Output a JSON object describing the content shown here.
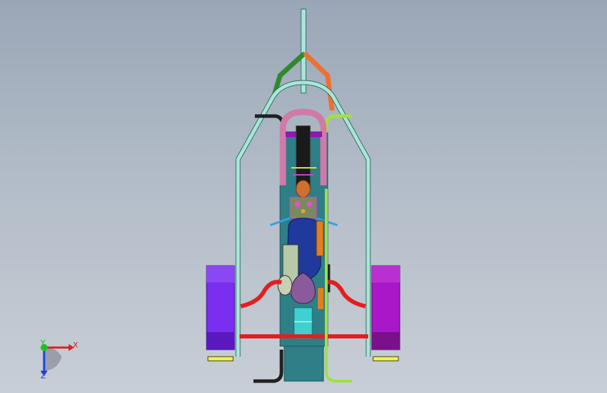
{
  "viewport": {
    "background_top": "#9aa6b6",
    "background_bottom": "#c8ced6"
  },
  "triad": {
    "x_label": "X",
    "y_label": "Y",
    "z_label": "Z",
    "x_color": "#e02020",
    "y_color": "#20c020",
    "z_color": "#2040e0"
  },
  "colors": {
    "frame_tube": "#a8e6d8",
    "frame_outline": "#3a6a60",
    "chassis_body": "#2e7f86",
    "pink_hoop": "#d07aa8",
    "green_bracket": "#2f8a2f",
    "orange_bracket": "#f07030",
    "lime_tube": "#a0e040",
    "black_tube": "#202020",
    "red_arm": "#e02020",
    "wheel_purple": "#7a2ef0",
    "wheel_magenta": "#a818c8",
    "blue_tank": "#1f3a9a",
    "seat": "#8a5a9a",
    "yellow_pad": "#f2f24a"
  }
}
